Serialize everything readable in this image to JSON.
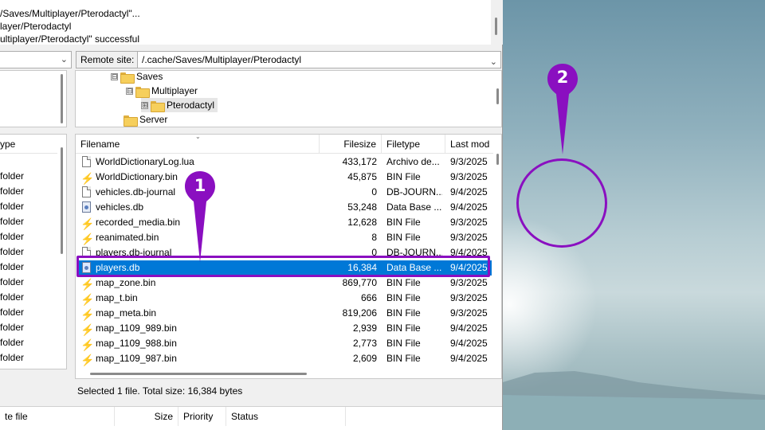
{
  "log": {
    "lines": [
      "/Saves/Multiplayer/Pterodactyl\"...",
      "layer/Pterodactyl",
      "ultiplayer/Pterodactyl\" successful"
    ]
  },
  "remote_site": {
    "label": "Remote site:",
    "path": "/.cache/Saves/Multiplayer/Pterodactyl"
  },
  "remote_tree": [
    {
      "label": "Saves",
      "expander": "⊟"
    },
    {
      "label": "Multiplayer",
      "expander": "⊟"
    },
    {
      "label": "Pterodactyl",
      "expander": "⊞"
    },
    {
      "label": "Server",
      "expander": ""
    }
  ],
  "local_list": {
    "header": "ype",
    "rows": [
      "folder",
      "folder",
      "folder",
      "folder",
      "folder",
      "folder",
      "folder",
      "folder",
      "folder",
      "folder",
      "folder",
      "folder",
      "folder",
      "folder"
    ]
  },
  "remote_list": {
    "columns": {
      "name": "Filename",
      "size": "Filesize",
      "type": "Filetype",
      "modified": "Last mod"
    },
    "rows": [
      {
        "name": "WorldDictionaryLog.lua",
        "size": "433,172",
        "type": "Archivo de...",
        "modified": "9/3/2025",
        "icon": "document-icon"
      },
      {
        "name": "WorldDictionary.bin",
        "size": "45,875",
        "type": "BIN File",
        "modified": "9/3/2025",
        "icon": "bin-file-icon"
      },
      {
        "name": "vehicles.db-journal",
        "size": "0",
        "type": "DB-JOURN...",
        "modified": "9/4/2025",
        "icon": "document-icon"
      },
      {
        "name": "vehicles.db",
        "size": "53,248",
        "type": "Data Base ...",
        "modified": "9/4/2025",
        "icon": "database-file-icon"
      },
      {
        "name": "recorded_media.bin",
        "size": "12,628",
        "type": "BIN File",
        "modified": "9/3/2025",
        "icon": "bin-file-icon"
      },
      {
        "name": "reanimated.bin",
        "size": "8",
        "type": "BIN File",
        "modified": "9/3/2025",
        "icon": "bin-file-icon"
      },
      {
        "name": "players.db-journal",
        "size": "0",
        "type": "DB-JOURN...",
        "modified": "9/4/2025",
        "icon": "document-icon"
      },
      {
        "name": "players.db",
        "size": "16,384",
        "type": "Data Base ...",
        "modified": "9/4/2025",
        "icon": "database-file-icon",
        "selected": true
      },
      {
        "name": "map_zone.bin",
        "size": "869,770",
        "type": "BIN File",
        "modified": "9/3/2025",
        "icon": "bin-file-icon"
      },
      {
        "name": "map_t.bin",
        "size": "666",
        "type": "BIN File",
        "modified": "9/3/2025",
        "icon": "bin-file-icon"
      },
      {
        "name": "map_meta.bin",
        "size": "819,206",
        "type": "BIN File",
        "modified": "9/3/2025",
        "icon": "bin-file-icon"
      },
      {
        "name": "map_1109_989.bin",
        "size": "2,939",
        "type": "BIN File",
        "modified": "9/4/2025",
        "icon": "bin-file-icon"
      },
      {
        "name": "map_1109_988.bin",
        "size": "2,773",
        "type": "BIN File",
        "modified": "9/4/2025",
        "icon": "bin-file-icon"
      },
      {
        "name": "map_1109_987.bin",
        "size": "2,609",
        "type": "BIN File",
        "modified": "9/4/2025",
        "icon": "bin-file-icon"
      }
    ]
  },
  "remote_status": "Selected 1 file. Total size: 16,384 bytes",
  "queue": {
    "columns": [
      "te file",
      "Size",
      "Priority",
      "Status"
    ]
  },
  "annotations": {
    "marker_1": "1",
    "marker_2": "2",
    "color": "#8a0fc0"
  }
}
